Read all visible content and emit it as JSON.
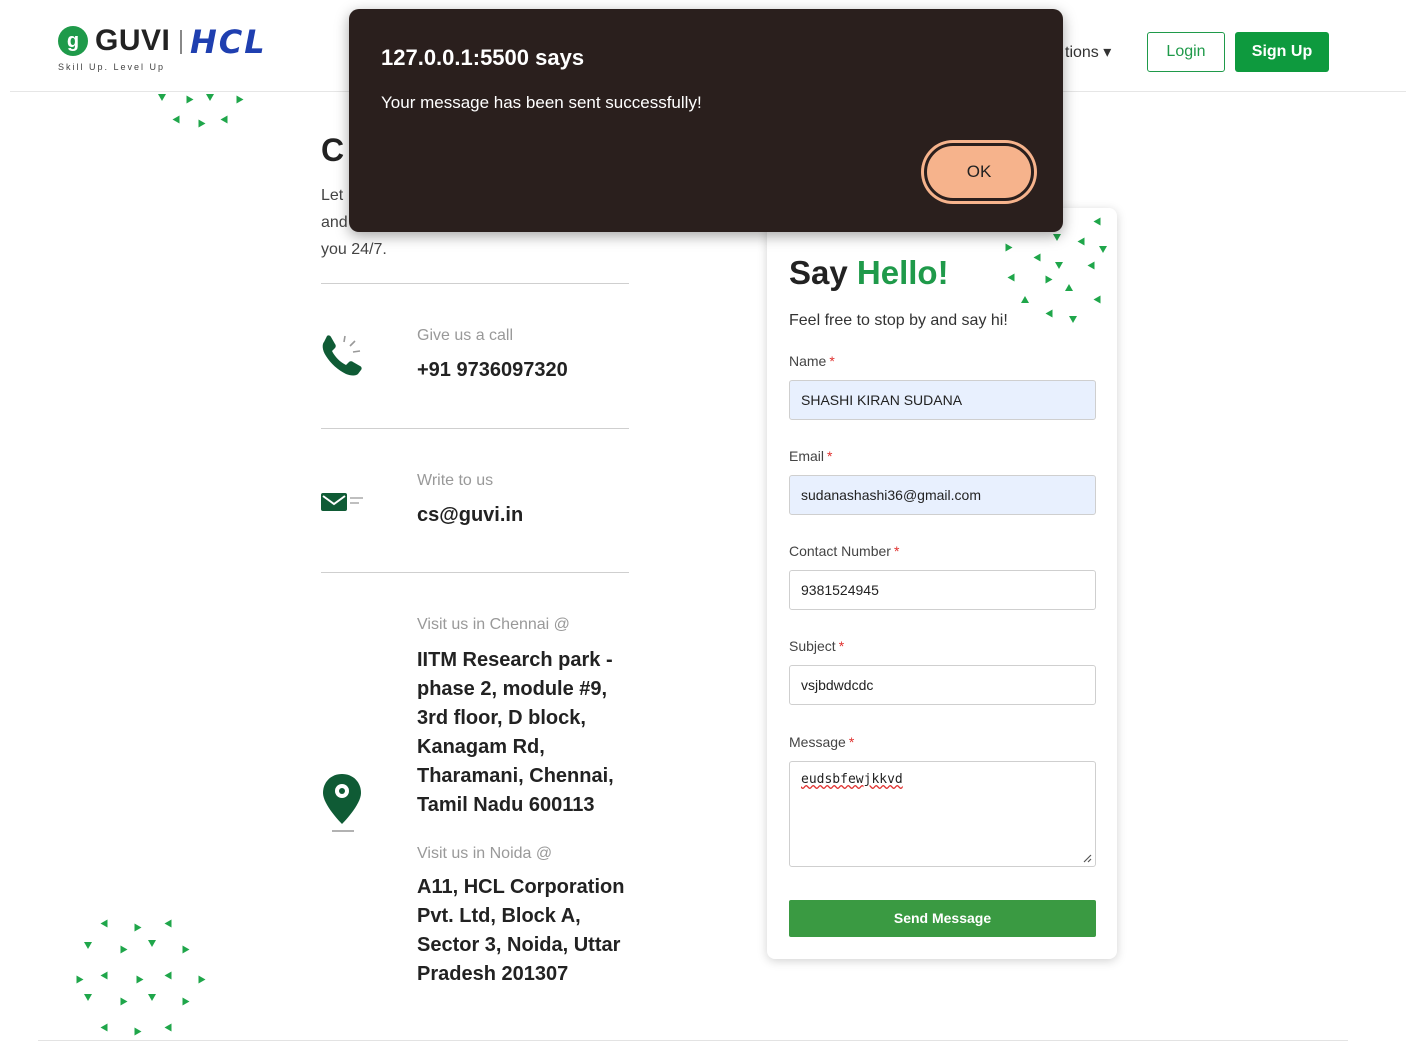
{
  "header": {
    "logo": {
      "brand": "GUVI",
      "partner": "HCL",
      "tagline": "Skill Up. Level Up",
      "mark": "g"
    },
    "nav_partial": "tions ▾",
    "login_label": "Login",
    "signup_label": "Sign Up"
  },
  "contact": {
    "title_partial": "C",
    "intro_lines": [
      "Let",
      "and",
      "you 24/7."
    ],
    "call": {
      "label": "Give us a call",
      "value": "+91 9736097320",
      "icon": "phone-icon"
    },
    "write": {
      "label": "Write to us",
      "value": "cs@guvi.in",
      "icon": "mail-icon"
    },
    "chennai": {
      "label": "Visit us in Chennai @",
      "lines": [
        "IITM Research park -",
        "phase 2, module #9,",
        "3rd floor, D block,",
        "Kanagam Rd,",
        "Tharamani, Chennai,",
        "Tamil Nadu 600113"
      ],
      "icon": "location-pin-icon"
    },
    "noida": {
      "label": "Visit us in Noida @",
      "lines": [
        "A11, HCL Corporation",
        "Pvt. Ltd, Block A,",
        "Sector 3, Noida, Uttar",
        "Pradesh 201307"
      ]
    }
  },
  "form": {
    "title_plain": "Say ",
    "title_highlight": "Hello!",
    "subtitle": "Feel free to stop by and say hi!",
    "required_mark": "*",
    "name_label": "Name",
    "name_value": "SHASHI KIRAN SUDANA",
    "email_label": "Email",
    "email_value": "sudanashashi36@gmail.com",
    "phone_label": "Contact Number",
    "phone_value": "9381524945",
    "subject_label": "Subject",
    "subject_value": "vsjbdwdcdc",
    "message_label": "Message",
    "message_value": "eudsbfewjkkvd",
    "send_label": "Send Message"
  },
  "alert": {
    "title": "127.0.0.1:5500 says",
    "message": "Your message has been sent successfully!",
    "ok_label": "OK"
  },
  "colors": {
    "brand_green": "#1f9a4a",
    "alert_bg": "#2a1f1d",
    "ok_button": "#f6b38c",
    "autofill_bg": "#e8f0fe"
  }
}
